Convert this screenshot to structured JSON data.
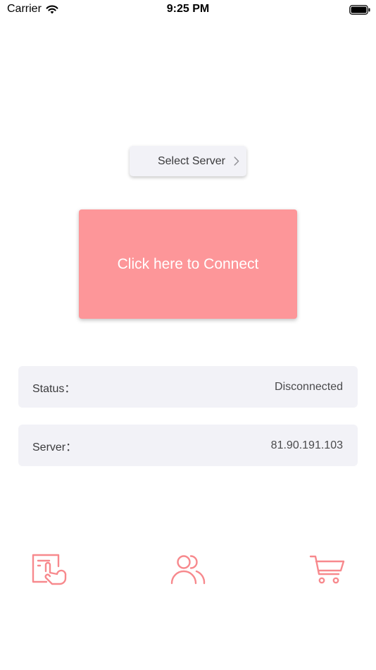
{
  "status_bar": {
    "carrier": "Carrier",
    "time": "9:25 PM",
    "icons": [
      "wifi-icon",
      "battery-icon"
    ]
  },
  "select_server": {
    "label": "Select Server",
    "icon": "chevron-right-icon"
  },
  "connect": {
    "label": "Click here to Connect",
    "color": "#fd9699"
  },
  "info": {
    "status": {
      "label": "Status：",
      "value": "Disconnected"
    },
    "server": {
      "label": "Server：",
      "value": "81.90.191.103"
    }
  },
  "bottom_nav": {
    "icons": [
      "touch-document-icon",
      "users-icon",
      "cart-icon"
    ],
    "color": "#f7898d"
  }
}
